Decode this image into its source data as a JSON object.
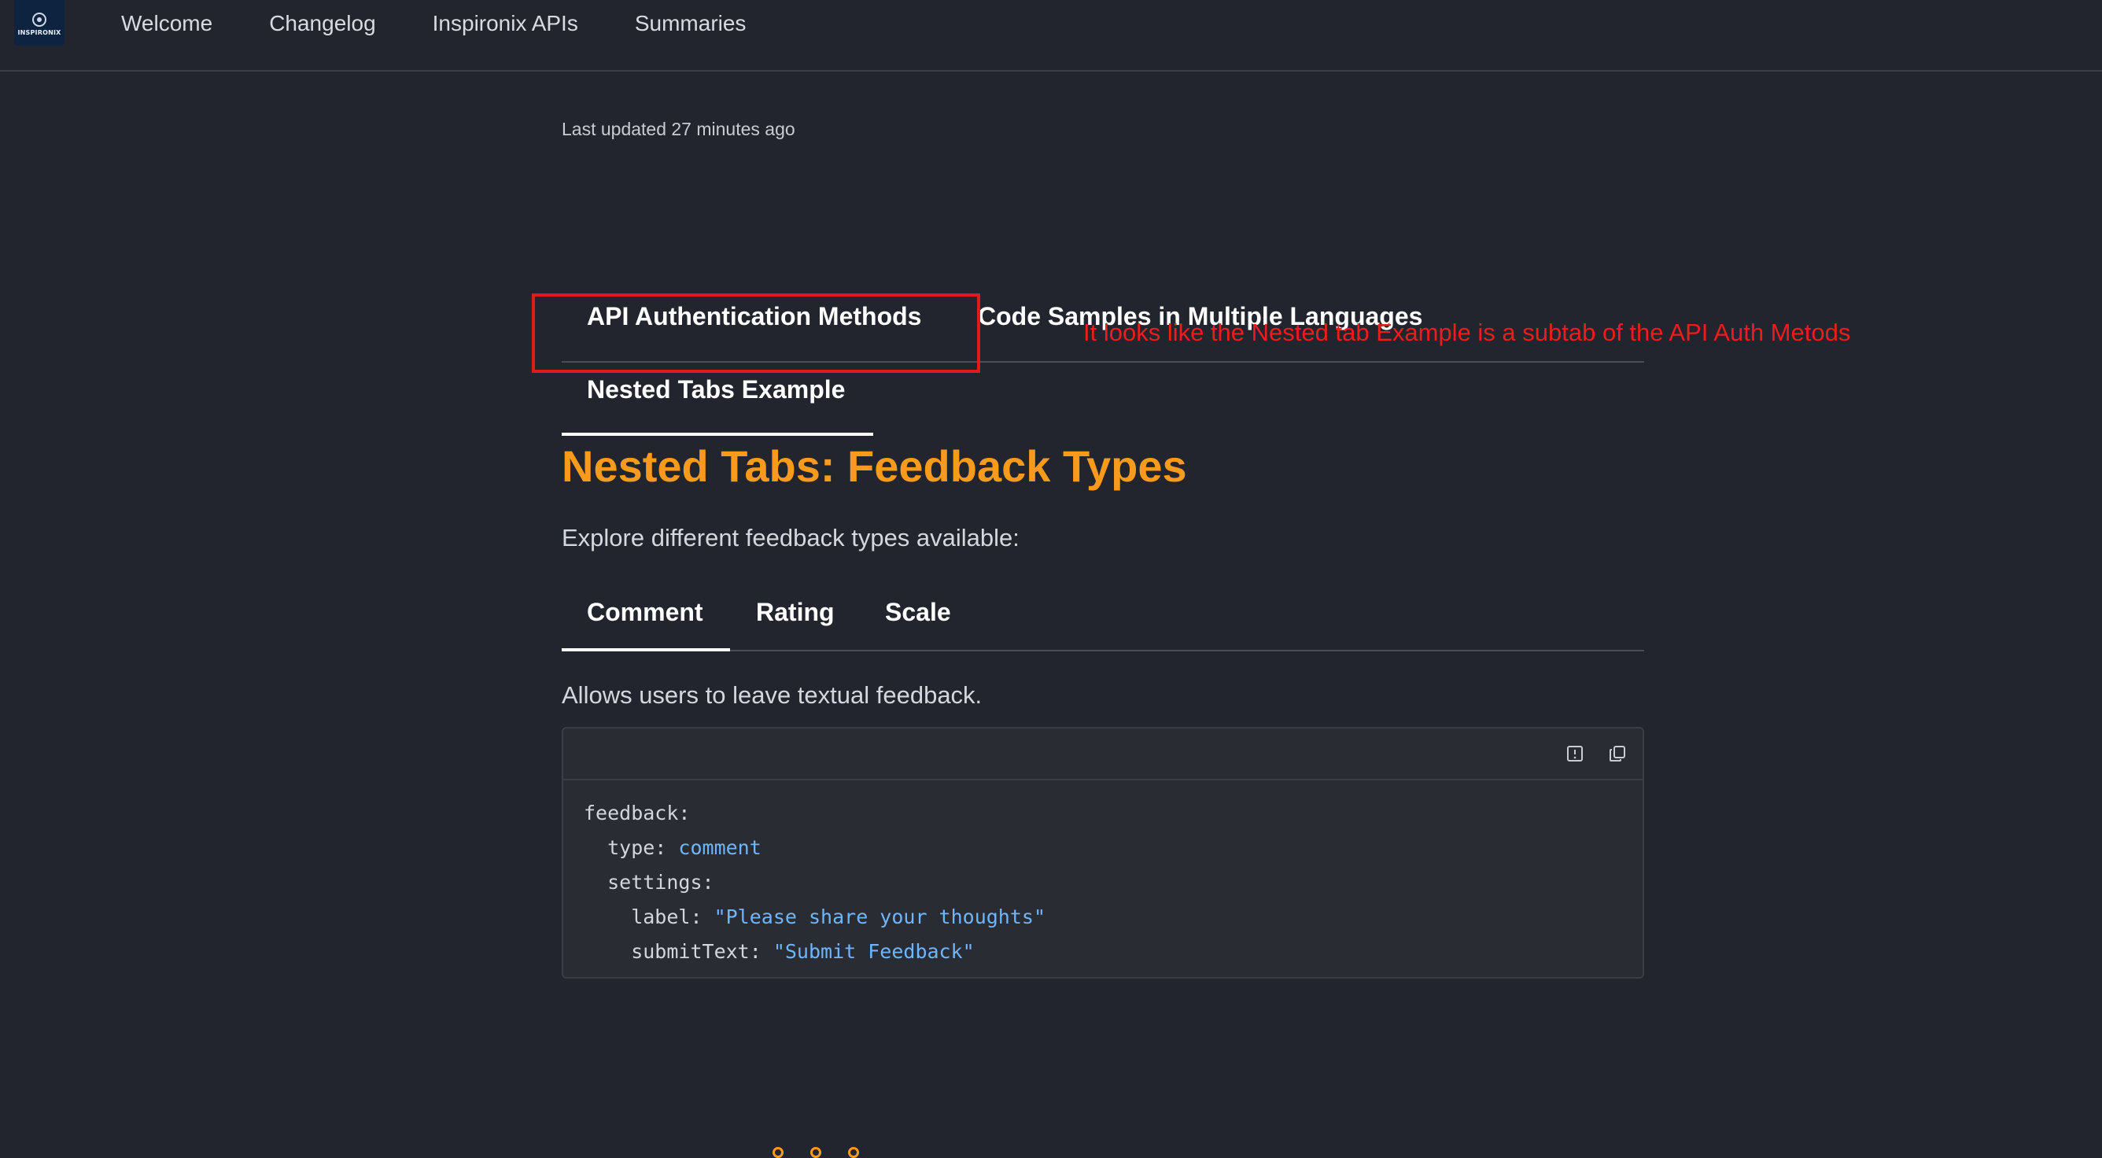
{
  "header": {
    "logo_text": "INSPIRONIX",
    "nav": [
      {
        "label": "Welcome"
      },
      {
        "label": "Changelog"
      },
      {
        "label": "Inspironix APIs"
      },
      {
        "label": "Summaries"
      }
    ]
  },
  "page": {
    "last_updated": "Last updated 27 minutes ago",
    "main_tabs": [
      {
        "label": "API Authentication Methods"
      },
      {
        "label": "Code Samples in Multiple Languages"
      },
      {
        "label": "Nested Tabs Example",
        "active": true
      }
    ],
    "annotation": "It looks like the Nested tab Example is a subtab of the API Auth Metods",
    "section_title": "Nested Tabs: Feedback Types",
    "section_desc": "Explore different feedback types available:",
    "sub_tabs": [
      {
        "label": "Comment",
        "active": true
      },
      {
        "label": "Rating"
      },
      {
        "label": "Scale"
      }
    ],
    "tab_desc": "Allows users to leave textual feedback.",
    "code": {
      "line1_key": "feedback:",
      "line2_key": "  type: ",
      "line2_val": "comment",
      "line3_key": "  settings:",
      "line4_key": "    label: ",
      "line4_val": "\"Please share your thoughts\"",
      "line5_key": "    submitText: ",
      "line5_val": "\"Submit Feedback\""
    }
  },
  "colors": {
    "background": "#22252d",
    "accent_orange": "#f89b1c",
    "annotation_red": "#e11b1b",
    "code_value_blue": "#6fb6ff"
  },
  "icons": [
    "logo-icon",
    "report-icon",
    "copy-icon"
  ]
}
